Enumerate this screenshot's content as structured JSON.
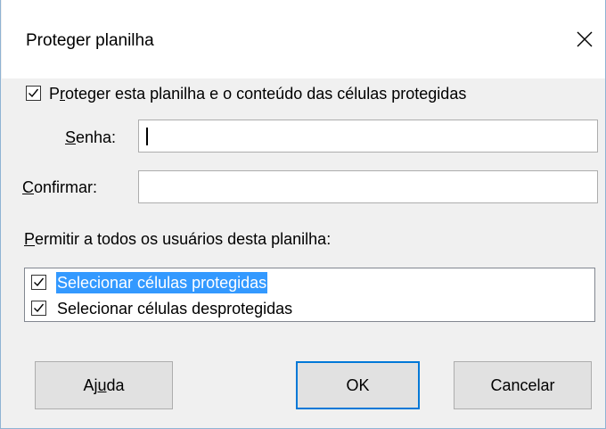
{
  "dialog": {
    "title": "Proteger planilha"
  },
  "protect": {
    "checked": true,
    "label_pre": "P",
    "label_accel": "r",
    "label_post": "oteger esta planilha e o conteúdo das células protegidas"
  },
  "password": {
    "label_accel": "S",
    "label_post": "enha:",
    "value": ""
  },
  "confirm": {
    "label_accel": "C",
    "label_post": "onfirmar:",
    "value": ""
  },
  "permissions": {
    "heading_accel": "P",
    "heading_post": "ermitir a todos os usuários desta planilha:",
    "items": [
      {
        "label": "Selecionar células protegidas",
        "checked": true,
        "selected": true
      },
      {
        "label": "Selecionar células desprotegidas",
        "checked": true,
        "selected": false
      }
    ]
  },
  "buttons": {
    "help_pre": "Aj",
    "help_accel": "u",
    "help_post": "da",
    "ok": "OK",
    "cancel": "Cancelar"
  },
  "colors": {
    "accent": "#0078d7",
    "selection": "#3399ff",
    "window_border": "#8fb3d3"
  },
  "icons": {
    "close": "close-icon",
    "check": "checkmark-icon"
  }
}
